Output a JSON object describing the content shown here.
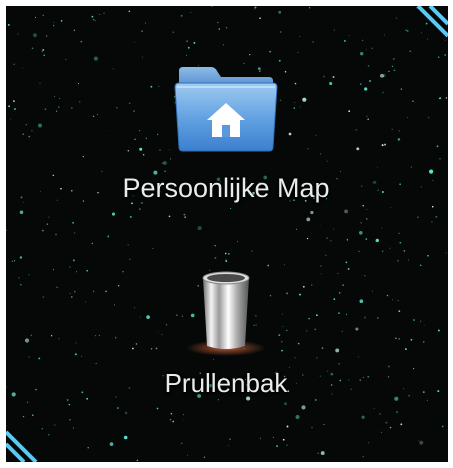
{
  "desktop": {
    "background_color": "#050807",
    "star_color": "#5ee6d2",
    "icons": [
      {
        "label": "Persoonlijke Map",
        "icon": "home-folder-icon"
      },
      {
        "label": "Prullenbak",
        "icon": "trash-can-icon"
      }
    ]
  }
}
